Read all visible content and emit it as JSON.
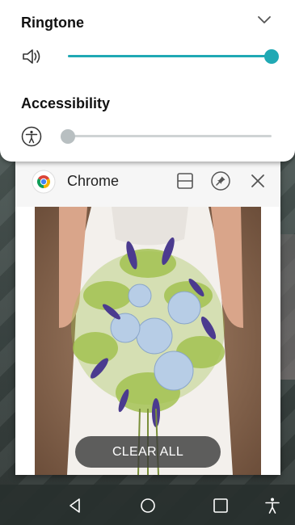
{
  "volume_panel": {
    "ringtone": {
      "label": "Ringtone",
      "level": 1.0
    },
    "accessibility": {
      "label": "Accessibility",
      "level": 0.0
    },
    "accent_color": "#20a9b4",
    "thumb_off_color": "#b8bfc1"
  },
  "recents": {
    "app": {
      "name": "Chrome",
      "icon": "chrome-logo",
      "actions": [
        "split-screen-icon",
        "pin-icon",
        "close-icon"
      ]
    },
    "clear_all_label": "CLEAR ALL"
  },
  "nav_bar": {
    "buttons": [
      "back-icon",
      "home-icon",
      "recent-apps-icon",
      "accessibility-icon"
    ]
  }
}
